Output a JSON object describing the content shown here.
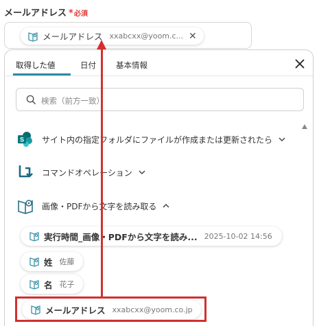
{
  "field": {
    "label": "メールアドレス",
    "asterisk": "*",
    "required": "必須",
    "chip_name": "メールアドレス",
    "chip_value": "xxabcxx@yoom.c...",
    "clear": "✕"
  },
  "panel": {
    "tabs": [
      "取得した値",
      "日付",
      "基本情報"
    ],
    "close": "✕",
    "search_placeholder": "検索（前方一致）"
  },
  "sections": [
    {
      "title": "サイト内の指定フォルダにファイルが作成または更新されたら",
      "icon": "sharepoint-icon",
      "expanded": false
    },
    {
      "title": "コマンドオペレーション",
      "icon": "command-icon",
      "expanded": false
    },
    {
      "title": "画像・PDFから文字を読み取る",
      "icon": "ocr-icon",
      "expanded": true
    }
  ],
  "items": [
    {
      "name": "実行時間_画像・PDFから文字を読み...",
      "value": "2025-10-02 14:56"
    },
    {
      "name": "姓",
      "value": "佐藤"
    },
    {
      "name": "名",
      "value": "花子"
    },
    {
      "name": "メールアドレス",
      "value": "xxabcxx@yoom.co.jp"
    }
  ],
  "colors": {
    "accent": "#2a8aa3",
    "highlight": "#d32f2f",
    "required": "#e53935"
  }
}
